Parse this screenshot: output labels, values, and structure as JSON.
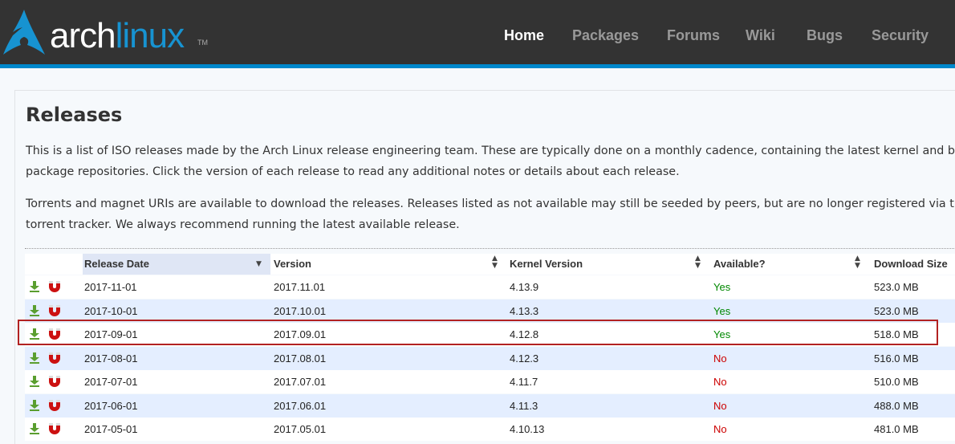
{
  "header": {
    "logo_arch": "arch",
    "logo_linux": "linux",
    "logo_tm": "TM",
    "nav": [
      {
        "label": "Home",
        "active": true
      },
      {
        "label": "Packages",
        "active": false
      },
      {
        "label": "Forums",
        "active": false
      },
      {
        "label": "Wiki",
        "active": false
      },
      {
        "label": "Bugs",
        "active": false
      },
      {
        "label": "Security",
        "active": false
      }
    ]
  },
  "main": {
    "title": "Releases",
    "paragraph1_line1": "This is a list of ISO releases made by the Arch Linux release engineering team. These are typically done on a monthly cadence, containing the latest kernel and base pac",
    "paragraph1_line2": "package repositories. Click the version of each release to read any additional notes or details about each release.",
    "paragraph2_line1": "Torrents and magnet URIs are available to download the releases. Releases listed as not available may still be seeded by peers, but are no longer registered via the offic",
    "paragraph2_line2": "torrent tracker. We always recommend running the latest available release."
  },
  "table": {
    "columns": {
      "date": "Release Date",
      "version": "Version",
      "kernel": "Kernel Version",
      "available": "Available?",
      "size": "Download Size"
    },
    "icons": {
      "download": "download-icon",
      "magnet": "magnet-icon"
    },
    "rows": [
      {
        "date": "2017-11-01",
        "version": "2017.11.01",
        "kernel": "4.13.9",
        "available": "Yes",
        "size": "523.0 MB"
      },
      {
        "date": "2017-10-01",
        "version": "2017.10.01",
        "kernel": "4.13.3",
        "available": "Yes",
        "size": "523.0 MB"
      },
      {
        "date": "2017-09-01",
        "version": "2017.09.01",
        "kernel": "4.12.8",
        "available": "Yes",
        "size": "518.0 MB"
      },
      {
        "date": "2017-08-01",
        "version": "2017.08.01",
        "kernel": "4.12.3",
        "available": "No",
        "size": "516.0 MB"
      },
      {
        "date": "2017-07-01",
        "version": "2017.07.01",
        "kernel": "4.11.7",
        "available": "No",
        "size": "510.0 MB"
      },
      {
        "date": "2017-06-01",
        "version": "2017.06.01",
        "kernel": "4.11.3",
        "available": "No",
        "size": "488.0 MB"
      },
      {
        "date": "2017-05-01",
        "version": "2017.05.01",
        "kernel": "4.10.13",
        "available": "No",
        "size": "481.0 MB"
      }
    ]
  },
  "colors": {
    "brand": "#1793d1",
    "link": "#0077bb",
    "yes": "#008800",
    "no": "#cc0000",
    "highlight": "#b22222"
  }
}
